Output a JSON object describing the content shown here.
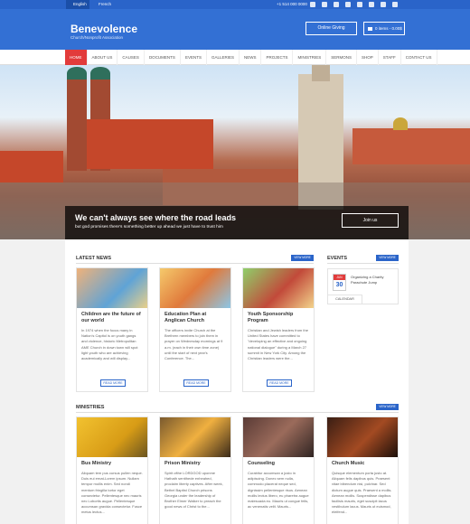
{
  "topbar": {
    "lang_active": "English",
    "lang_other": "French",
    "phone": "+1 514 000 0000"
  },
  "header": {
    "brand": "Benevolence",
    "tagline": "Church/Nonprofit Association",
    "giving_label": "Online Giving",
    "cart_label": "0 items - 0.00$"
  },
  "nav": [
    "HOME",
    "ABOUT US",
    "CAUSES",
    "DOCUMENTS",
    "EVENTS",
    "GALLERIES",
    "NEWS",
    "PROJECTS",
    "MINISTRIES",
    "SERMONS",
    "SHOP",
    "STAFF",
    "CONTACT US"
  ],
  "hero": {
    "title": "We can't always see where the road leads",
    "subtitle": "but god promises there's something better up ahead we just have to trust him",
    "join_label": "Join us"
  },
  "news": {
    "title": "LATEST NEWS",
    "view_more": "VIEW MORE",
    "read_more": "READ MORE",
    "items": [
      {
        "title": "Children are the future of our world",
        "body": "In 1974 when the focus many in Nation's Capitol is on youth gangs and violence, historic Metropolitan AME Church in down town will spot light youth who are achieving academically and will display..."
      },
      {
        "title": "Education Plan at Anglican Church",
        "body": "The officers invite Church at the Brethren members to join them in prayer on Wednesday mornings at 9 a.m. (each in their own time zone) until the start of next year's Conference. The..."
      },
      {
        "title": "Youth Sponsorship Program",
        "body": "Christian and Jewish leaders from the United States have committed to \"developing an effective and ongoing national dialogue\" during a March 27 summit in New York City. Among the Christian leaders were the..."
      }
    ]
  },
  "events": {
    "title": "EVENTS",
    "view_more": "VIEW MORE",
    "month": "JUN",
    "day": "30",
    "event_title": "Organizing a Charity Parachute Jump",
    "calendar_label": "CALENDAR"
  },
  "ministries": {
    "title": "MINISTRIES",
    "view_more": "VIEW MORE",
    "items": [
      {
        "title": "Bus Ministry",
        "body": "Aliquam tem pus cursus pullen neque. Duis eui ernat-Lorem ipsum. Nullam tempor mollis enim. Sed nondi mentum fringilla tortor eget consectetur. Pellentesque nec mauris nec Lobortis augue. Pellentesque accumsan gravida consectetur. Fusce metus lectus..."
      },
      {
        "title": "Prison Ministry",
        "body": "Spirit ofthe LORDGOD uponme Hathath sentthede enheahed, proclaim liberty captives. After week, Bethel Baptist Church prisons Georgia under the leadership of Brother Elmer Walker to preach the good news of Christ to the..."
      },
      {
        "title": "Counseling",
        "body": "Curabitur accumsan a justo in adipiscing. Donec sem nulla, commodo placerat neque sed, dignissim pellentesque risus. Aenean mollis lectus libero, eu pharetra augue malesuada eu. Mauris ut congue felis, ac venenatis velit. Mauris..."
      },
      {
        "title": "Church Music",
        "body": "Quisque elementum porta justo at. Aliquam felis dapibus quis. Praesent vitae bibendum nisi, pulvinar. Sed dictum augue quis. Praesent a mollis. Aenean mollis. Suspendisse dapibus facilisis mauris, eget suscipit lacus vestibulum lacus. Mauris ut euismod, eleifend..."
      }
    ]
  }
}
